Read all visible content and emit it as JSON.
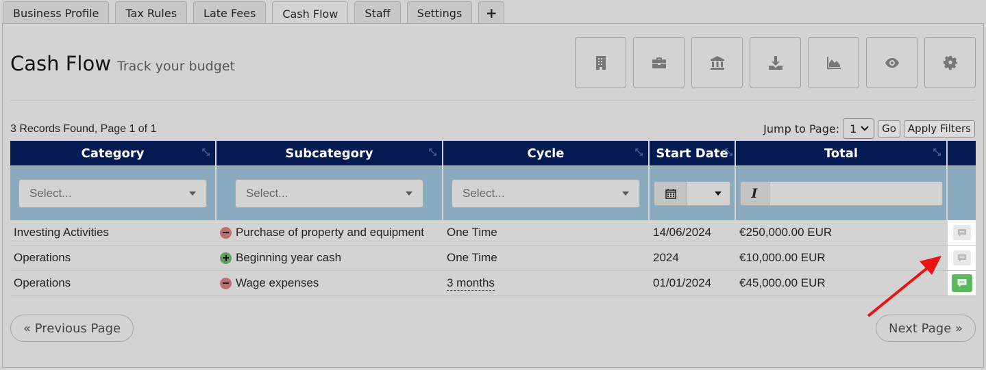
{
  "tabs": [
    {
      "label": "Business Profile",
      "active": false
    },
    {
      "label": "Tax Rules",
      "active": false
    },
    {
      "label": "Late Fees",
      "active": false
    },
    {
      "label": "Cash Flow",
      "active": true
    },
    {
      "label": "Staff",
      "active": false
    },
    {
      "label": "Settings",
      "active": false
    },
    {
      "label": "+",
      "active": false
    }
  ],
  "header": {
    "title": "Cash Flow",
    "subtitle": "Track your budget"
  },
  "toolbar": [
    {
      "icon": "building-icon"
    },
    {
      "icon": "briefcase-icon"
    },
    {
      "icon": "bank-icon"
    },
    {
      "icon": "download-icon"
    },
    {
      "icon": "area-chart-icon"
    },
    {
      "icon": "eye-icon"
    },
    {
      "icon": "gear-icon"
    }
  ],
  "records_text": "3 Records Found, Page 1 of 1",
  "jump": {
    "label": "Jump to Page:",
    "page": "1",
    "go": "Go",
    "apply": "Apply Filters"
  },
  "table": {
    "headers": [
      "Category",
      "Subcategory",
      "Cycle",
      "Start Date",
      "Total"
    ],
    "filters": {
      "placeholder": "Select...",
      "total_icon": "I"
    },
    "rows": [
      {
        "category": "Investing Activities",
        "sign": "minus",
        "subcategory": "Purchase of property and equipment",
        "cycle": "One Time",
        "start": "14/06/2024",
        "total": "€250,000.00 EUR",
        "comment": "grey"
      },
      {
        "category": "Operations",
        "sign": "plus",
        "subcategory": "Beginning year cash",
        "cycle": "One Time",
        "start": "2024",
        "total": "€10,000.00 EUR",
        "comment": "grey"
      },
      {
        "category": "Operations",
        "sign": "minus",
        "subcategory": "Wage expenses",
        "cycle": "3 months",
        "start": "01/01/2024",
        "total": "€45,000.00 EUR",
        "comment": "green"
      }
    ]
  },
  "pager": {
    "prev": "« Previous Page",
    "next": "Next Page »"
  },
  "colors": {
    "header_bg": "#051a52",
    "filter_bg": "#8aaabf",
    "annotation_arrow": "#ee1111",
    "comment_active": "#5cb85c"
  }
}
